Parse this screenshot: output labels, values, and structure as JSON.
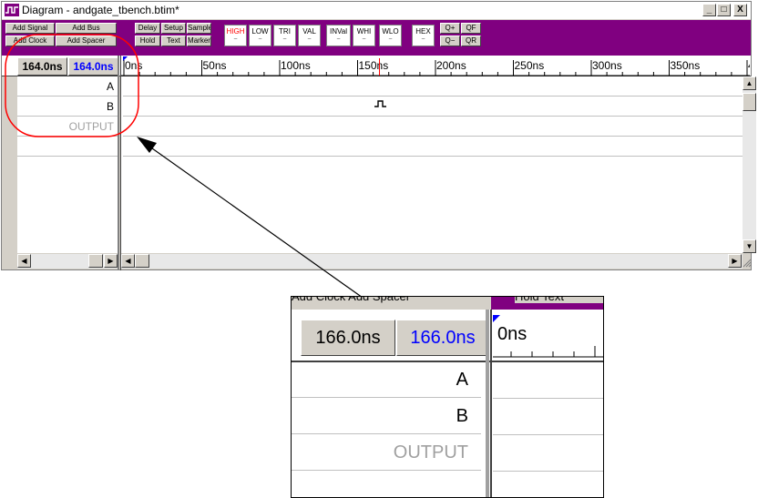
{
  "window": {
    "title": "Diagram - andgate_tbench.btim*",
    "controls": {
      "minimize": "_",
      "maximize": "□",
      "close": "X"
    }
  },
  "toolbar": {
    "add_signal": "Add Signal",
    "add_bus": "Add Bus",
    "add_clock": "Add Clock",
    "add_spacer": "Add Spacer",
    "delay": "Delay",
    "setup": "Setup",
    "sample": "Sample",
    "hold": "Hold",
    "text": "Text",
    "marker": "Marker",
    "state_buttons": [
      {
        "label": "HIGH",
        "color": "#ff0000"
      },
      {
        "label": "LOW",
        "color": "#000000"
      },
      {
        "label": "TRI",
        "color": "#000000"
      },
      {
        "label": "VAL",
        "color": "#000000"
      },
      {
        "label": "INVal",
        "color": "#000000"
      },
      {
        "label": "WHI",
        "color": "#000000"
      },
      {
        "label": "WLO",
        "color": "#000000"
      },
      {
        "label": "HEX",
        "color": "#000000"
      }
    ],
    "zoom_in": "Q+",
    "zoom_full": "QF",
    "zoom_out": "Q−",
    "zoom_reset": "QR"
  },
  "timebar": {
    "cursor_time": "164.0ns",
    "marker_time": "164.0ns",
    "ticks": [
      "0ns",
      "50ns",
      "100ns",
      "150ns",
      "200ns",
      "250ns",
      "300ns",
      "350ns",
      "4"
    ]
  },
  "signals": [
    {
      "name": "A",
      "color": "#000000"
    },
    {
      "name": "B",
      "color": "#000000"
    },
    {
      "name": "OUTPUT",
      "color": "#a0a0a0"
    }
  ],
  "zoom_inset": {
    "cursor_time": "166.0ns",
    "marker_time": "166.0ns",
    "tick_start": "0ns",
    "top_partial": "Add Clock  Add Spacer",
    "top_partial2": "Hold  Text",
    "signals": [
      {
        "name": "A",
        "color": "#000000"
      },
      {
        "name": "B",
        "color": "#000000"
      },
      {
        "name": "OUTPUT",
        "color": "#a0a0a0"
      }
    ]
  },
  "colors": {
    "toolbar_bg": "#800080",
    "highlight_circle": "#ff0000",
    "marker_blue": "#0000ff"
  }
}
